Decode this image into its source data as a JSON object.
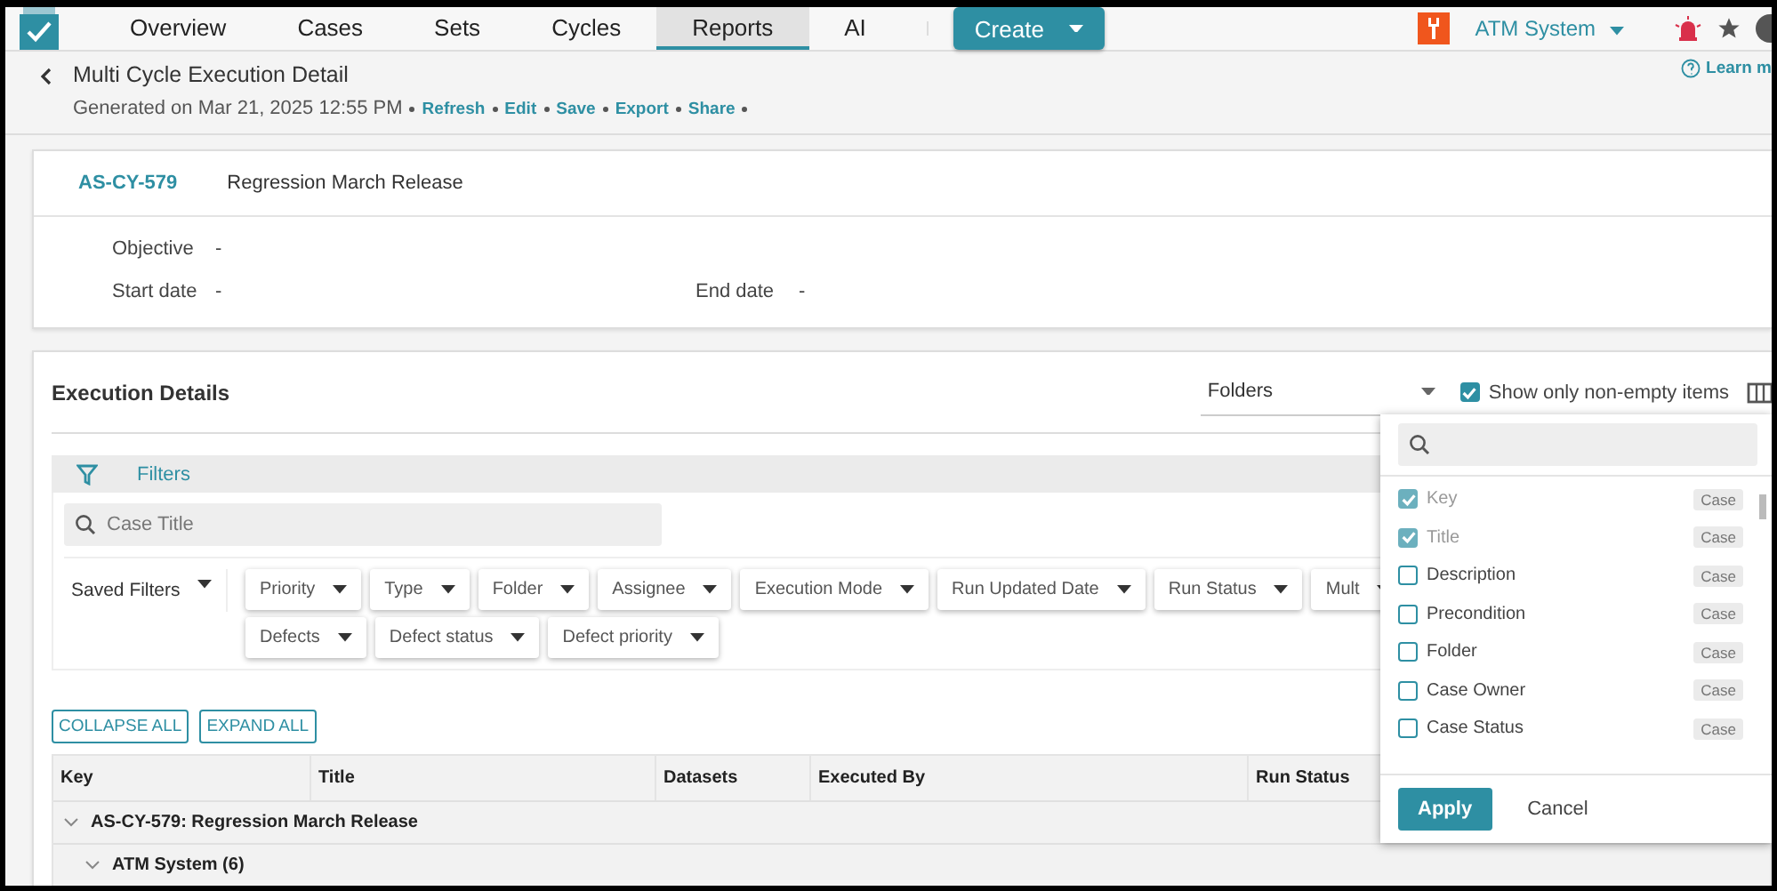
{
  "nav": {
    "tabs": [
      {
        "label": "Overview",
        "selected": false
      },
      {
        "label": "Cases",
        "selected": false
      },
      {
        "label": "Sets",
        "selected": false
      },
      {
        "label": "Cycles",
        "selected": false
      },
      {
        "label": "Reports",
        "selected": true
      },
      {
        "label": "AI",
        "selected": false
      }
    ],
    "create_button": "Create",
    "project": "ATM System"
  },
  "header": {
    "title": "Multi Cycle Execution Detail",
    "generated": "Generated on Mar 21, 2025 12:55 PM",
    "links": [
      "Refresh",
      "Edit",
      "Save",
      "Export",
      "Share"
    ],
    "learn_more": "Learn m"
  },
  "cycle": {
    "key": "AS-CY-579",
    "name": "Regression March Release",
    "objective_label": "Objective",
    "objective": "-",
    "start_label": "Start date",
    "start": "-",
    "end_label": "End date",
    "end": "-"
  },
  "execution": {
    "title": "Execution Details",
    "grouping": "Folders",
    "non_empty": {
      "label": "Show only non-empty items",
      "checked": true
    },
    "filters_label": "Filters",
    "search_placeholder": "Case Title",
    "saved_filters": "Saved Filters",
    "filter_rows": [
      [
        "Priority",
        "Type",
        "Folder",
        "Assignee",
        "Execution Mode",
        "Run Updated Date",
        "Run Status",
        "Mult"
      ],
      [
        "Defects",
        "Defect status",
        "Defect priority"
      ]
    ],
    "collapse_all": "COLLAPSE ALL",
    "expand_all": "EXPAND ALL",
    "columns": [
      "Key",
      "Title",
      "Datasets",
      "Executed By",
      "Run Status"
    ],
    "rows": [
      {
        "label": "AS-CY-579: Regression March Release",
        "expanded": true,
        "children": [
          {
            "label": "ATM System (6)",
            "expanded": true
          }
        ]
      }
    ]
  },
  "column_picker": {
    "items": [
      {
        "label": "Key",
        "checked": true,
        "disabled": true,
        "tag": "Case"
      },
      {
        "label": "Title",
        "checked": true,
        "disabled": true,
        "tag": "Case"
      },
      {
        "label": "Description",
        "checked": false,
        "disabled": false,
        "tag": "Case"
      },
      {
        "label": "Precondition",
        "checked": false,
        "disabled": false,
        "tag": "Case"
      },
      {
        "label": "Folder",
        "checked": false,
        "disabled": false,
        "tag": "Case"
      },
      {
        "label": "Case Owner",
        "checked": false,
        "disabled": false,
        "tag": "Case"
      },
      {
        "label": "Case Status",
        "checked": false,
        "disabled": false,
        "tag": "Case"
      }
    ],
    "apply": "Apply",
    "cancel": "Cancel"
  }
}
